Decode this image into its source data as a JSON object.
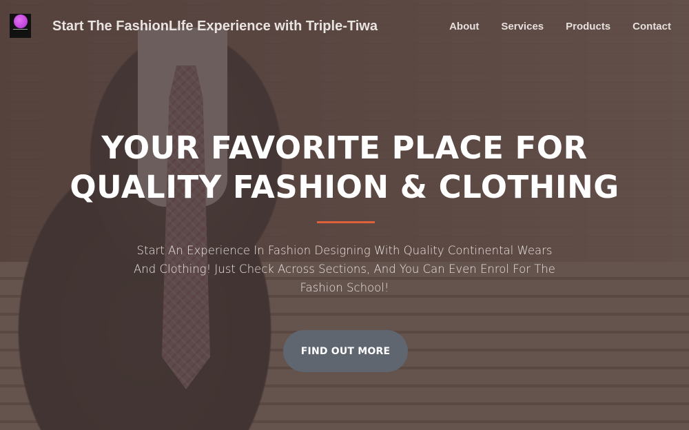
{
  "navbar": {
    "brand_title": "Start The FashionLIfe Experience with Triple-Tiwa",
    "links": [
      {
        "label": "About"
      },
      {
        "label": "Services"
      },
      {
        "label": "Products"
      },
      {
        "label": "Contact"
      }
    ]
  },
  "hero": {
    "headline_line1": "YOUR FAVORITE PLACE FOR",
    "headline_line2": "QUALITY FASHION & CLOTHING",
    "lead": "Start An Experience In Fashion Designing With Quality Continental Wears And Clothing! Just Check Across Sections, And You Can Even Enrol For The Fashion School!",
    "cta_label": "FIND OUT MORE"
  },
  "colors": {
    "accent_divider": "#e0603c",
    "cta_background": "#5f6670",
    "overlay": "#46373480",
    "logo_accent": "#b02ed0"
  },
  "icons": {
    "logo": "triple-tiwa-logo-icon"
  }
}
